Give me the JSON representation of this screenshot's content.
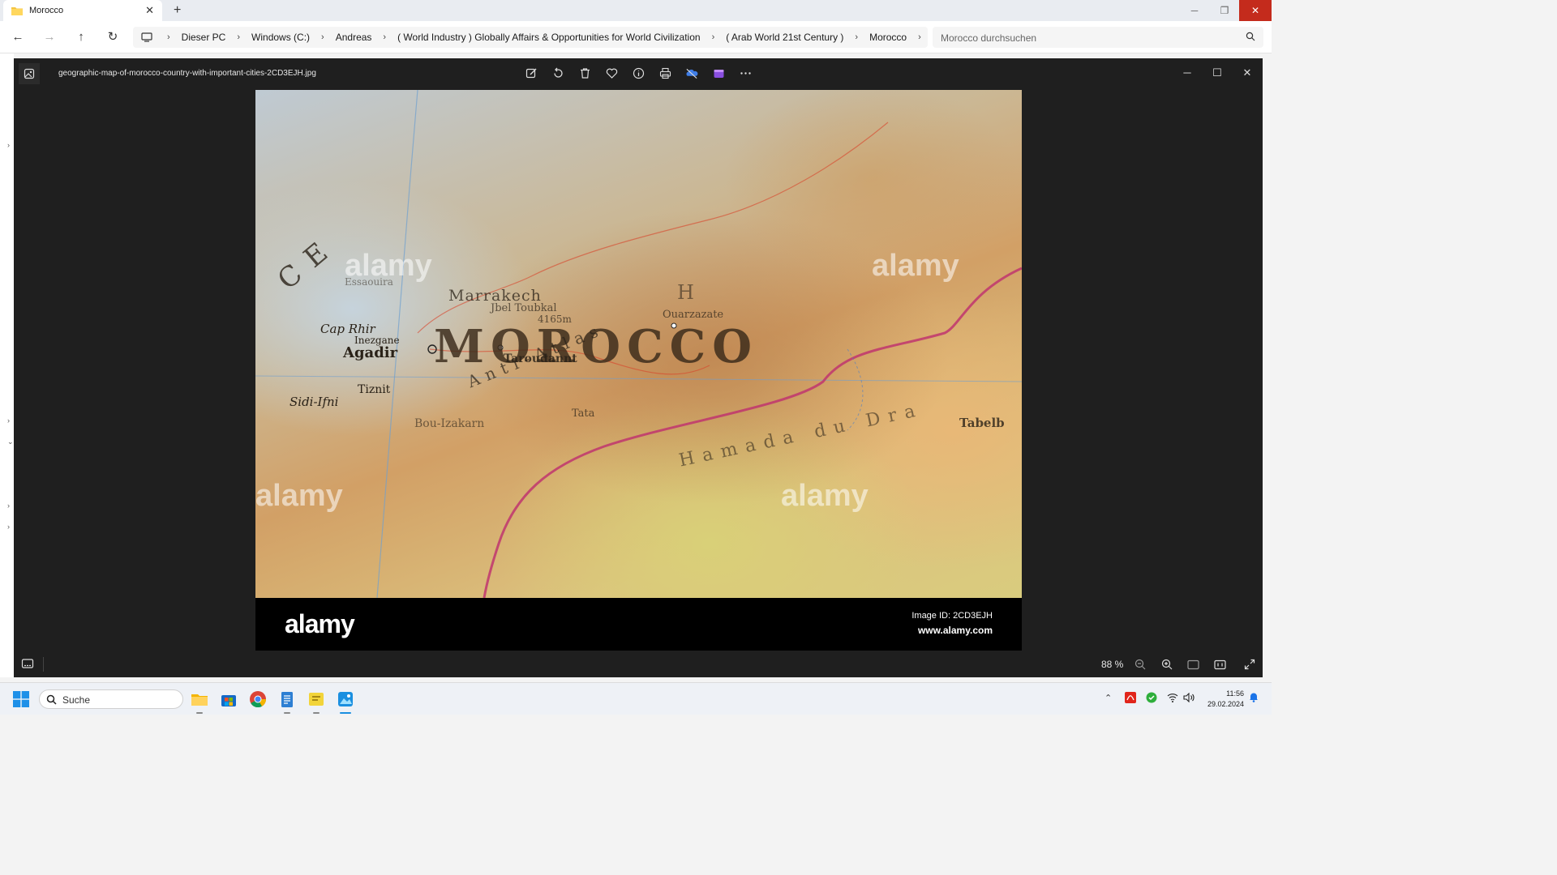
{
  "explorer": {
    "tab_title": "Morocco",
    "breadcrumbs": [
      "Dieser PC",
      "Windows (C:)",
      "Andreas",
      "( World Industry ) Globally Affairs & Opportunities for World Civilization",
      "( Arab World 21st Century )",
      "Morocco"
    ],
    "search_placeholder": "Morocco durchsuchen"
  },
  "viewer": {
    "filename": "geographic-map-of-morocco-country-with-important-cities-2CD3EJH.jpg",
    "zoom": "88 %",
    "toolbar_icons": [
      "edit-icon",
      "rotate-icon",
      "delete-icon",
      "favorite-icon",
      "info-icon",
      "print-icon",
      "onedrive-icon",
      "clipchamp-icon",
      "more-icon"
    ]
  },
  "image": {
    "map_labels": {
      "country": "MOROCCO",
      "marrakech": "Marrakech",
      "jbel": "Jbel Toubkal",
      "elev": "4165m",
      "ouarzazate": "Ouarzazate",
      "caprhir": "Cap Rhir",
      "inezgane": "Inezgane",
      "agadir": "Agadir",
      "taroudannt": "Taroudannt",
      "tiznit": "Tiznit",
      "sidiifni": "Sidi-Ifni",
      "antiatlas": "Anti-Atlas",
      "tata": "Tata",
      "bouizakarn": "Bou-Izakarn",
      "hammada": "Hamada du Dra",
      "tabelb": "Tabelb",
      "essaouira": "Essaouira",
      "ocean": "CE",
      "haut": "H"
    },
    "watermark": "alamy",
    "stock_logo": "alamy",
    "stock_id": "Image ID: 2CD3EJH",
    "stock_url": "www.alamy.com"
  },
  "taskbar": {
    "search_label": "Suche",
    "time": "11:56",
    "date": "29.02.2024"
  },
  "colors": {
    "close_red": "#c42b1c",
    "viewer_bg": "#1f1f1f",
    "taskbar_bg": "#eef1f6"
  }
}
